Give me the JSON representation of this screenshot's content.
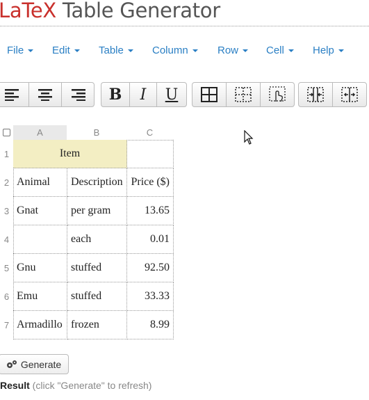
{
  "app": {
    "title_accent": "LaTeX",
    "title_rest": " Table Generator"
  },
  "menu": [
    "File",
    "Edit",
    "Table",
    "Column",
    "Row",
    "Cell",
    "Help"
  ],
  "format_buttons": {
    "bold": "B",
    "italic": "I",
    "underline": "U"
  },
  "columns": [
    "A",
    "B",
    "C"
  ],
  "rows": [
    "1",
    "2",
    "3",
    "4",
    "5",
    "6",
    "7"
  ],
  "table": {
    "merged_header": "Item",
    "cells": [
      [
        "Animal",
        "Description",
        "Price ($)"
      ],
      [
        "Gnat",
        "per gram",
        "13.65"
      ],
      [
        "",
        "each",
        "0.01"
      ],
      [
        "Gnu",
        "stuffed",
        "92.50"
      ],
      [
        "Emu",
        "stuffed",
        "33.33"
      ],
      [
        "Armadillo",
        "frozen",
        "8.99"
      ]
    ]
  },
  "generate_button": "Generate",
  "result": {
    "label": "Result",
    "hint": " (click \"Generate\" to refresh)"
  }
}
